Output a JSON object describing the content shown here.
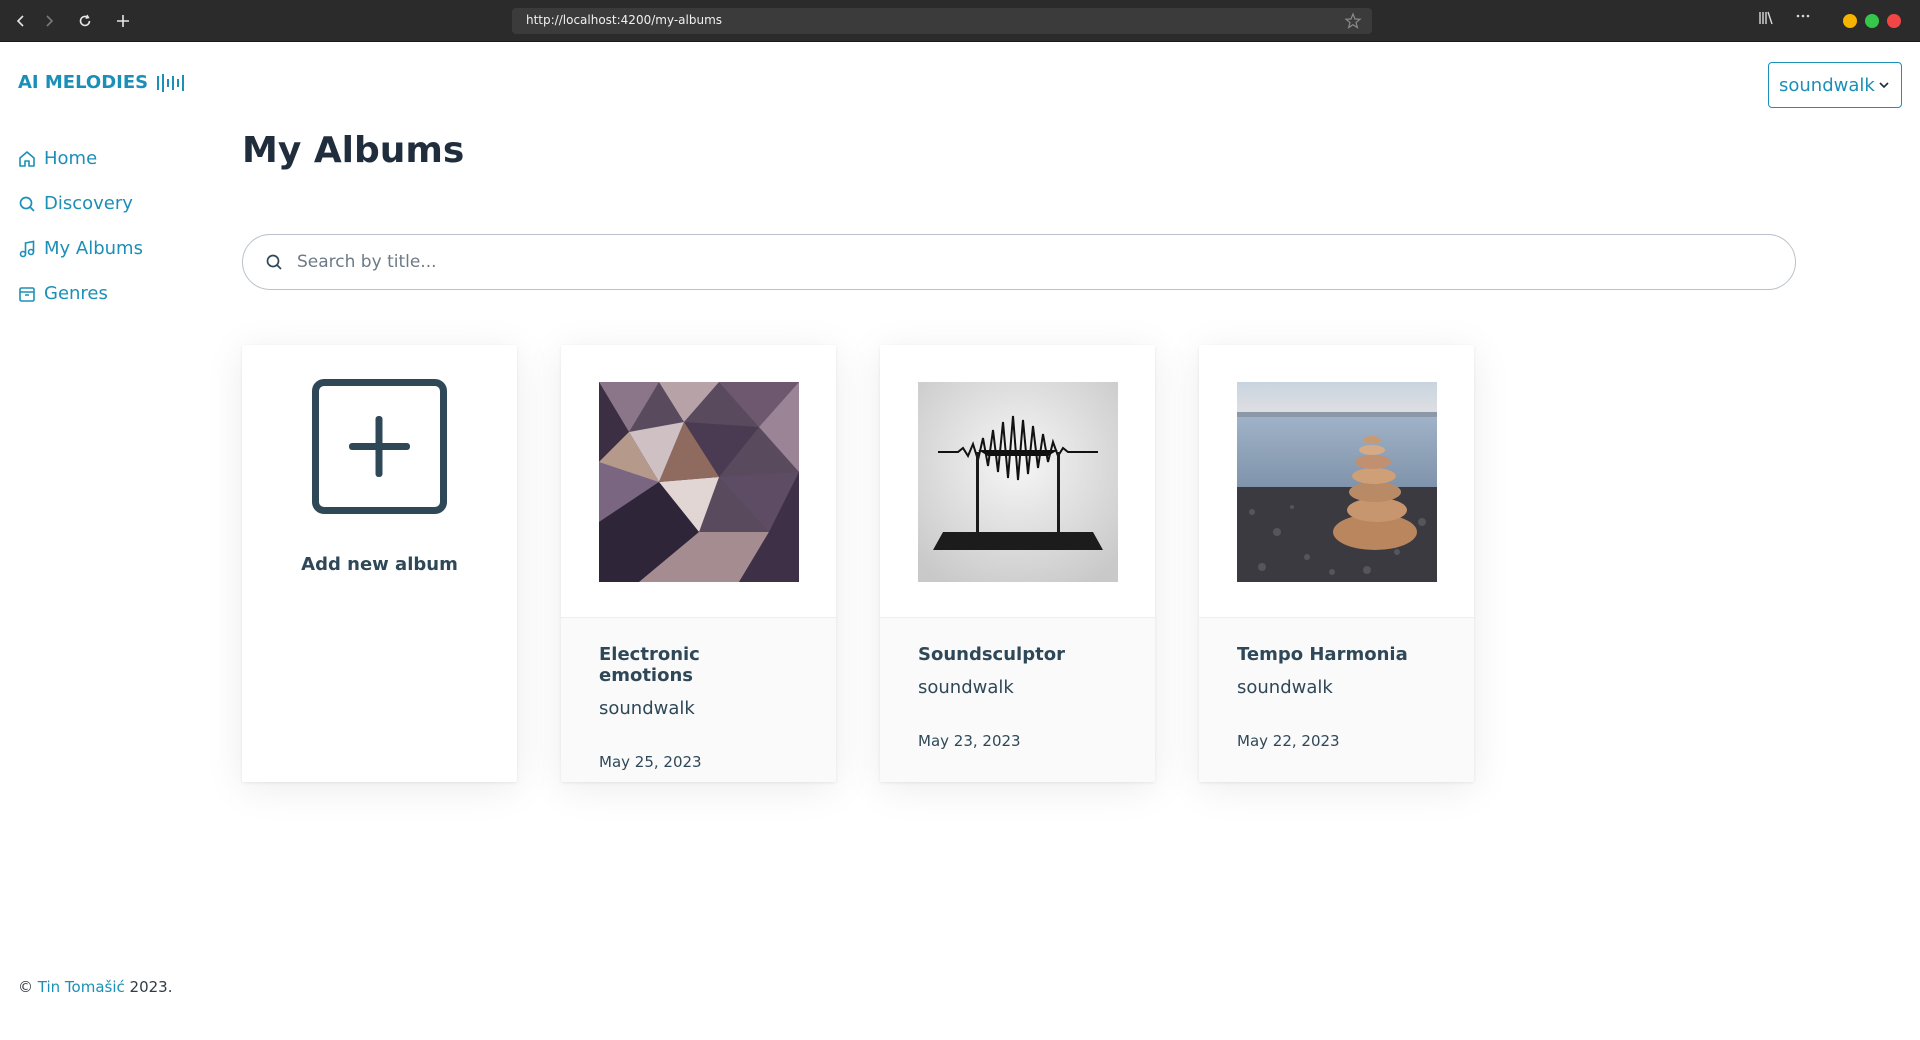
{
  "browser": {
    "url": "http://localhost:4200/my-albums"
  },
  "app": {
    "logo_text": "AI MELODIES",
    "accent_color": "#1b8fb8"
  },
  "sidebar": {
    "items": [
      {
        "label": "Home",
        "icon": "home-icon"
      },
      {
        "label": "Discovery",
        "icon": "search-icon"
      },
      {
        "label": "My Albums",
        "icon": "music-note-icon"
      },
      {
        "label": "Genres",
        "icon": "archive-box-icon"
      }
    ]
  },
  "header": {
    "user_select_value": "soundwalk"
  },
  "main": {
    "title": "My Albums",
    "search_placeholder": "Search by title...",
    "add_album_label": "Add new album",
    "albums": [
      {
        "title": "Electronic emotions",
        "artist": "soundwalk",
        "date": "May 25, 2023",
        "cover": "crystal-facets"
      },
      {
        "title": "Soundsculptor",
        "artist": "soundwalk",
        "date": "May 23, 2023",
        "cover": "waveform-sculpture"
      },
      {
        "title": "Tempo Harmonia",
        "artist": "soundwalk",
        "date": "May 22, 2023",
        "cover": "stacked-stones"
      }
    ]
  },
  "footer": {
    "copyright_symbol": "©",
    "author": "Tin Tomašić",
    "year_suffix": "2023."
  }
}
